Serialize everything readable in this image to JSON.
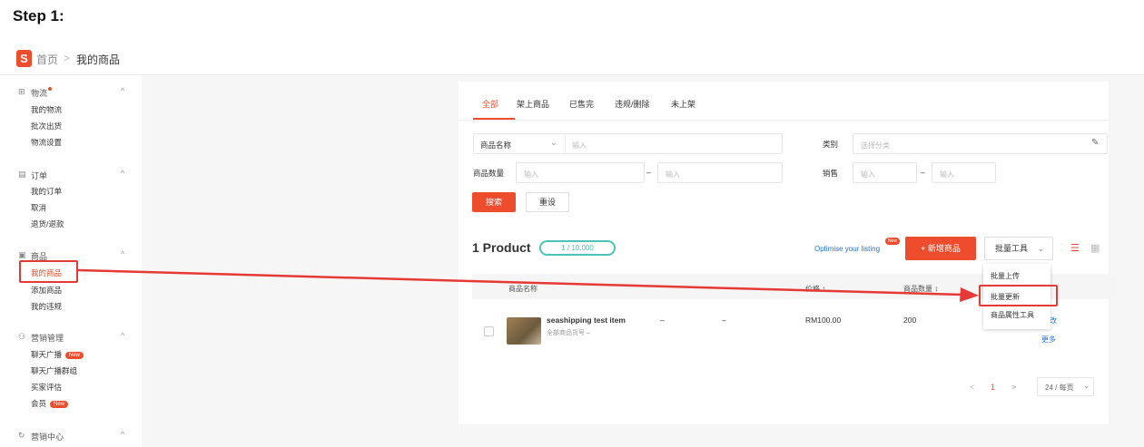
{
  "step_label": "Step 1:",
  "breadcrumb": {
    "home": "首页",
    "separator": ">",
    "current": "我的商品"
  },
  "sidebar": {
    "sections": [
      {
        "title": "物流",
        "items": [
          "我的物流",
          "批次出货",
          "物流设置"
        ]
      },
      {
        "title": "订单",
        "items": [
          "我的订单",
          "取消",
          "退货/退款"
        ]
      },
      {
        "title": "商品",
        "items": [
          "我的商品",
          "添加商品",
          "我的违规"
        ]
      },
      {
        "title": "营销管理",
        "items": [
          "聊天广播",
          "聊天广播群组",
          "买家评估",
          "会员"
        ]
      },
      {
        "title": "营销中心",
        "items": []
      }
    ],
    "new_badge": "New"
  },
  "tabs": [
    "全部",
    "架上商品",
    "已售完",
    "违规/删除",
    "未上架"
  ],
  "filters": {
    "name_select": "商品名称",
    "name_placeholder": "输入",
    "category_label": "类别",
    "category_placeholder": "选择分类",
    "stock_label": "商品数量",
    "stock_min_placeholder": "输入",
    "stock_max_placeholder": "输入",
    "sales_label": "销售",
    "sales_min_placeholder": "输入",
    "sales_max_placeholder": "输入",
    "range_dash": "–",
    "search_btn": "搜索",
    "reset_btn": "重设"
  },
  "toolbar": {
    "count_title": "1 Product",
    "quota": "1 / 10,000",
    "optimise": "Optimise your listing",
    "optimise_badge": "New",
    "add_btn": "+ 新增商品",
    "bulk_tools": "批量工具",
    "dropdown": [
      "批量上传",
      "批量更新",
      "商品属性工具"
    ]
  },
  "table": {
    "headers": [
      "商品名称",
      "",
      "",
      "价格",
      "商品数量"
    ],
    "row": {
      "name": "seashipping test item",
      "sub": "全部商品货号 –",
      "c1": "–",
      "c2": "–",
      "price": "RM100.00",
      "stock": "200",
      "action1": "改",
      "action2": "更多"
    }
  },
  "pagination": {
    "prev": "<",
    "page": "1",
    "next": ">",
    "per_page": "24 / 每页"
  },
  "colors": {
    "brand": "#ee4d2d",
    "annotation": "#e53935",
    "teal": "#4cc3b4",
    "link": "#2673dd"
  }
}
